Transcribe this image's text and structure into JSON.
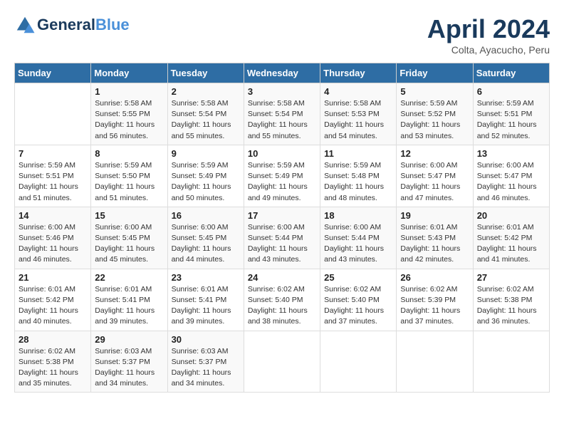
{
  "header": {
    "logo_line1": "General",
    "logo_line2": "Blue",
    "month": "April 2024",
    "location": "Colta, Ayacucho, Peru"
  },
  "weekdays": [
    "Sunday",
    "Monday",
    "Tuesday",
    "Wednesday",
    "Thursday",
    "Friday",
    "Saturday"
  ],
  "weeks": [
    [
      {
        "day": "",
        "info": ""
      },
      {
        "day": "1",
        "info": "Sunrise: 5:58 AM\nSunset: 5:55 PM\nDaylight: 11 hours\nand 56 minutes."
      },
      {
        "day": "2",
        "info": "Sunrise: 5:58 AM\nSunset: 5:54 PM\nDaylight: 11 hours\nand 55 minutes."
      },
      {
        "day": "3",
        "info": "Sunrise: 5:58 AM\nSunset: 5:54 PM\nDaylight: 11 hours\nand 55 minutes."
      },
      {
        "day": "4",
        "info": "Sunrise: 5:58 AM\nSunset: 5:53 PM\nDaylight: 11 hours\nand 54 minutes."
      },
      {
        "day": "5",
        "info": "Sunrise: 5:59 AM\nSunset: 5:52 PM\nDaylight: 11 hours\nand 53 minutes."
      },
      {
        "day": "6",
        "info": "Sunrise: 5:59 AM\nSunset: 5:51 PM\nDaylight: 11 hours\nand 52 minutes."
      }
    ],
    [
      {
        "day": "7",
        "info": "Sunrise: 5:59 AM\nSunset: 5:51 PM\nDaylight: 11 hours\nand 51 minutes."
      },
      {
        "day": "8",
        "info": "Sunrise: 5:59 AM\nSunset: 5:50 PM\nDaylight: 11 hours\nand 51 minutes."
      },
      {
        "day": "9",
        "info": "Sunrise: 5:59 AM\nSunset: 5:49 PM\nDaylight: 11 hours\nand 50 minutes."
      },
      {
        "day": "10",
        "info": "Sunrise: 5:59 AM\nSunset: 5:49 PM\nDaylight: 11 hours\nand 49 minutes."
      },
      {
        "day": "11",
        "info": "Sunrise: 5:59 AM\nSunset: 5:48 PM\nDaylight: 11 hours\nand 48 minutes."
      },
      {
        "day": "12",
        "info": "Sunrise: 6:00 AM\nSunset: 5:47 PM\nDaylight: 11 hours\nand 47 minutes."
      },
      {
        "day": "13",
        "info": "Sunrise: 6:00 AM\nSunset: 5:47 PM\nDaylight: 11 hours\nand 46 minutes."
      }
    ],
    [
      {
        "day": "14",
        "info": "Sunrise: 6:00 AM\nSunset: 5:46 PM\nDaylight: 11 hours\nand 46 minutes."
      },
      {
        "day": "15",
        "info": "Sunrise: 6:00 AM\nSunset: 5:45 PM\nDaylight: 11 hours\nand 45 minutes."
      },
      {
        "day": "16",
        "info": "Sunrise: 6:00 AM\nSunset: 5:45 PM\nDaylight: 11 hours\nand 44 minutes."
      },
      {
        "day": "17",
        "info": "Sunrise: 6:00 AM\nSunset: 5:44 PM\nDaylight: 11 hours\nand 43 minutes."
      },
      {
        "day": "18",
        "info": "Sunrise: 6:00 AM\nSunset: 5:44 PM\nDaylight: 11 hours\nand 43 minutes."
      },
      {
        "day": "19",
        "info": "Sunrise: 6:01 AM\nSunset: 5:43 PM\nDaylight: 11 hours\nand 42 minutes."
      },
      {
        "day": "20",
        "info": "Sunrise: 6:01 AM\nSunset: 5:42 PM\nDaylight: 11 hours\nand 41 minutes."
      }
    ],
    [
      {
        "day": "21",
        "info": "Sunrise: 6:01 AM\nSunset: 5:42 PM\nDaylight: 11 hours\nand 40 minutes."
      },
      {
        "day": "22",
        "info": "Sunrise: 6:01 AM\nSunset: 5:41 PM\nDaylight: 11 hours\nand 39 minutes."
      },
      {
        "day": "23",
        "info": "Sunrise: 6:01 AM\nSunset: 5:41 PM\nDaylight: 11 hours\nand 39 minutes."
      },
      {
        "day": "24",
        "info": "Sunrise: 6:02 AM\nSunset: 5:40 PM\nDaylight: 11 hours\nand 38 minutes."
      },
      {
        "day": "25",
        "info": "Sunrise: 6:02 AM\nSunset: 5:40 PM\nDaylight: 11 hours\nand 37 minutes."
      },
      {
        "day": "26",
        "info": "Sunrise: 6:02 AM\nSunset: 5:39 PM\nDaylight: 11 hours\nand 37 minutes."
      },
      {
        "day": "27",
        "info": "Sunrise: 6:02 AM\nSunset: 5:38 PM\nDaylight: 11 hours\nand 36 minutes."
      }
    ],
    [
      {
        "day": "28",
        "info": "Sunrise: 6:02 AM\nSunset: 5:38 PM\nDaylight: 11 hours\nand 35 minutes."
      },
      {
        "day": "29",
        "info": "Sunrise: 6:03 AM\nSunset: 5:37 PM\nDaylight: 11 hours\nand 34 minutes."
      },
      {
        "day": "30",
        "info": "Sunrise: 6:03 AM\nSunset: 5:37 PM\nDaylight: 11 hours\nand 34 minutes."
      },
      {
        "day": "",
        "info": ""
      },
      {
        "day": "",
        "info": ""
      },
      {
        "day": "",
        "info": ""
      },
      {
        "day": "",
        "info": ""
      }
    ]
  ]
}
